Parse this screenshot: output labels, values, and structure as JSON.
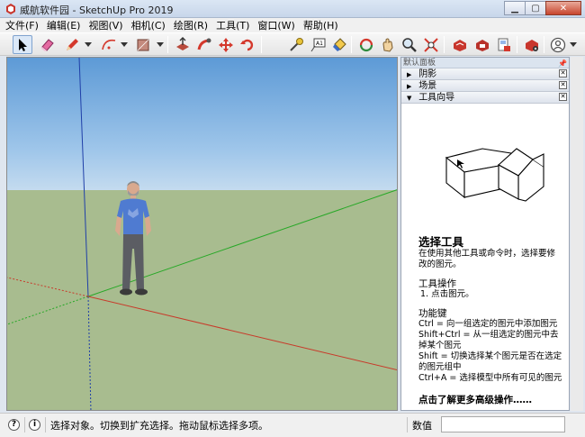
{
  "window": {
    "title": "威航软件园 - SketchUp Pro 2019",
    "icon": "sketchup-icon"
  },
  "menu": [
    {
      "label": "文件(F)"
    },
    {
      "label": "编辑(E)"
    },
    {
      "label": "视图(V)"
    },
    {
      "label": "相机(C)"
    },
    {
      "label": "绘图(R)"
    },
    {
      "label": "工具(T)"
    },
    {
      "label": "窗口(W)"
    },
    {
      "label": "帮助(H)"
    }
  ],
  "toolbar": {
    "tools": [
      "select-icon",
      "eraser-icon",
      "pencil-icon",
      "arc-icon",
      "rectangle-icon",
      "push-pull-icon",
      "follow-me-icon",
      "move-icon",
      "rotate-icon",
      "tape-measure-icon",
      "text-icon",
      "paint-bucket-icon",
      "orbit-icon",
      "pan-icon",
      "zoom-icon",
      "zoom-extents-icon",
      "warehouse-icon",
      "extension-warehouse-icon",
      "send-to-layout-icon",
      "extension-manager-icon",
      "account-icon"
    ]
  },
  "panel": {
    "title": "默认面板",
    "sections": [
      {
        "label": "阴影",
        "expanded": false
      },
      {
        "label": "场景",
        "expanded": false
      },
      {
        "label": "工具向导",
        "expanded": true
      }
    ],
    "help": {
      "title": "选择工具",
      "description": "在使用其他工具或命令时，选择要修改的图元。",
      "ops_title": "工具操作",
      "ops": [
        "1. 点击图元。"
      ],
      "keys_title": "功能键",
      "keys": [
        "Ctrl = 向一组选定的图元中添加图元",
        "Shift+Ctrl = 从一组选定的图元中去掉某个图元",
        "Shift = 切换选择某个图元是否在选定的图元组中",
        "Ctrl+A = 选择模型中所有可见的图元"
      ],
      "more": "点击了解更多高级操作……"
    }
  },
  "status": {
    "message": "选择对象。切换到扩充选择。拖动鼠标选择多项。",
    "measure_label": "数值",
    "measure_value": ""
  }
}
